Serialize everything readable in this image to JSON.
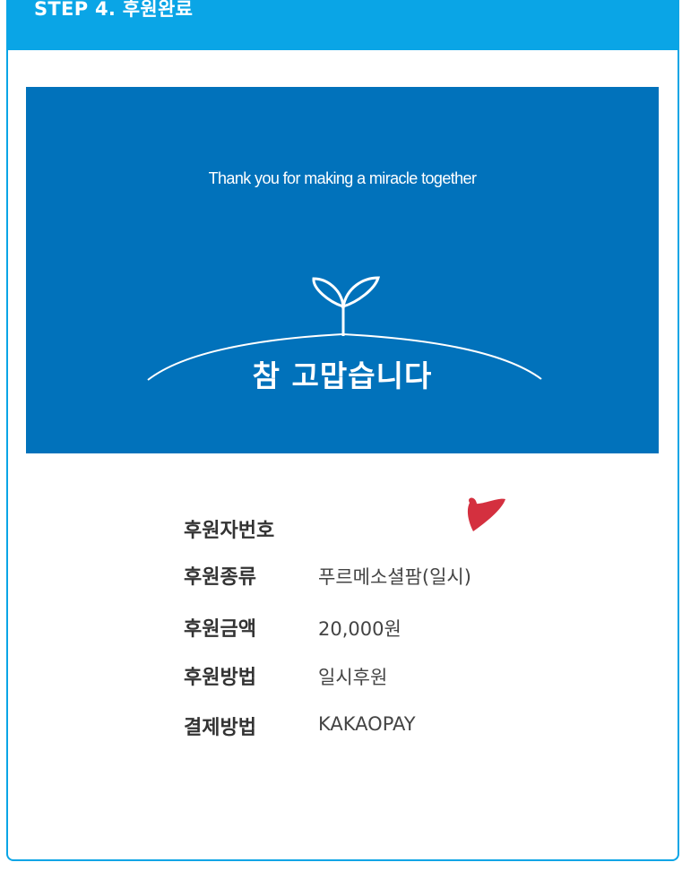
{
  "header": {
    "step_title": "STEP 4. 후원완료"
  },
  "banner": {
    "subtitle": "Thank you for making a miracle together",
    "title": "참 고맙습니다",
    "colors": {
      "background": "#0172bb",
      "text": "#ffffff"
    },
    "art_icon": "sprout-icon"
  },
  "details": {
    "rows": [
      {
        "label": "후원자번호",
        "value": ""
      },
      {
        "label": "후원종류",
        "value": "푸르메소셜팜(일시)"
      },
      {
        "label": "후원금액",
        "value": "20,000원"
      },
      {
        "label": "후원방법",
        "value": "일시후원"
      },
      {
        "label": "결제방법",
        "value": "KAKAOPAY"
      }
    ]
  },
  "decor": {
    "icon": "heart-icon",
    "color": "#d4303f"
  },
  "colors": {
    "accent": "#0aa5e6"
  }
}
